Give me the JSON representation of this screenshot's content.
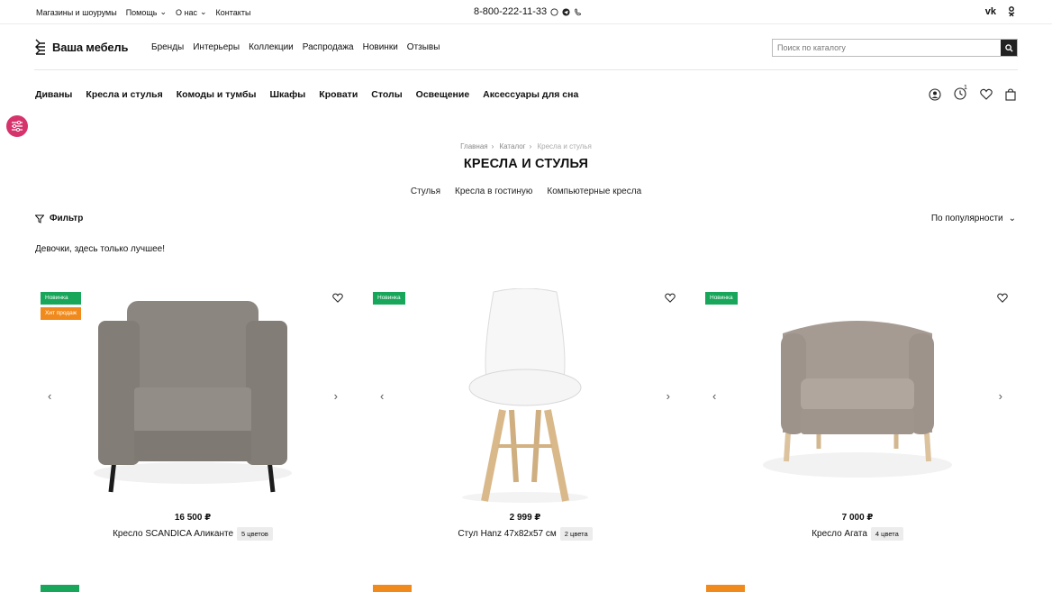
{
  "topbar": {
    "links": [
      "Магазины и шоурумы",
      "Помощь",
      "О нас",
      "Контакты"
    ],
    "phone": "8-800-222-11-33",
    "social": [
      "vk-icon",
      "ok-icon"
    ]
  },
  "header": {
    "logo_text": "Ваша мебель",
    "nav": [
      "Бренды",
      "Интерьеры",
      "Коллекции",
      "Распродажа",
      "Новинки",
      "Отзывы"
    ],
    "search_placeholder": "Поиск по каталогу"
  },
  "catnav": [
    "Диваны",
    "Кресла и стулья",
    "Комоды и тумбы",
    "Шкафы",
    "Кровати",
    "Столы",
    "Освещение",
    "Аксессуары для сна"
  ],
  "history_count": "1",
  "breadcrumbs": [
    "Главная",
    "Каталог",
    "Кресла и стулья"
  ],
  "page_title": "КРЕСЛА И СТУЛЬЯ",
  "subcategories": [
    "Стулья",
    "Кресла в гостиную",
    "Компьютерные кресла"
  ],
  "filter_label": "Фильтр",
  "sort_label": "По популярности",
  "promo_text": "Девочки, здесь только лучшее!",
  "badges": {
    "new": "Новинка",
    "hit": "Хит продаж"
  },
  "products": [
    {
      "price": "16 500 ₽",
      "name": "Кресло SCANDICA Аликанте",
      "colors": "5 цветов",
      "badges": [
        "new",
        "hit"
      ]
    },
    {
      "price": "2 999 ₽",
      "name": "Стул Hanz 47x82x57 см",
      "colors": "2 цвета",
      "badges": [
        "new"
      ]
    },
    {
      "price": "7 000 ₽",
      "name": "Кресло Агата",
      "colors": "4 цвета",
      "badges": [
        "new"
      ]
    }
  ],
  "colors": {
    "new_badge": "#17a65a",
    "hit_badge": "#f08a1c",
    "fab": "#d6336c"
  }
}
